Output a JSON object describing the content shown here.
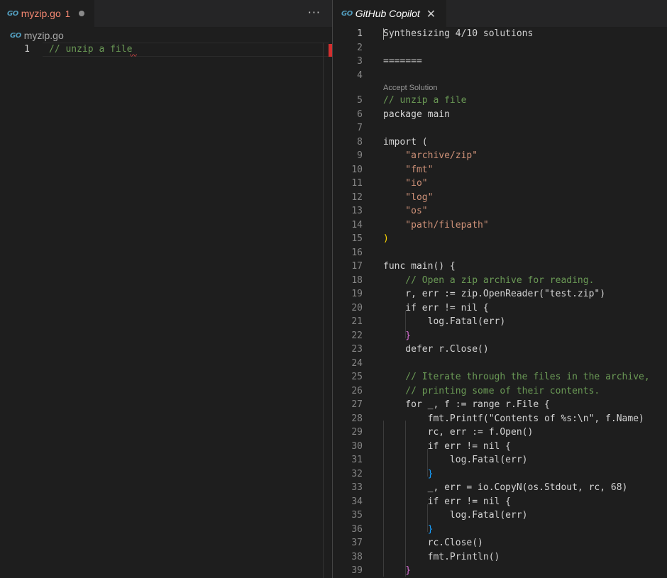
{
  "left_tab": {
    "icon": "GO",
    "title": "myzip.go",
    "problems": "1",
    "more": "···"
  },
  "breadcrumb": {
    "icon": "GO",
    "file": "myzip.go"
  },
  "left_editor": {
    "line_number": "1",
    "code": "// unzip a file"
  },
  "right_tab": {
    "icon": "GO",
    "title": "GitHub Copilot",
    "close": "✕"
  },
  "copilot": {
    "accept_solution": "Accept Solution"
  },
  "colors": {
    "background": "#1e1e1e",
    "tabbar": "#252526",
    "error": "#f48771",
    "comment": "#6a9955",
    "keyword": "#569cd6",
    "control": "#c586c0",
    "string": "#ce9178",
    "function": "#dcdcaa",
    "variable": "#9cdcfe"
  },
  "code_lines": [
    "Synthesizing 4/10 solutions",
    "",
    "=======",
    "",
    "// unzip a file",
    "package main",
    "",
    "import (",
    "    \"archive/zip\"",
    "    \"fmt\"",
    "    \"io\"",
    "    \"log\"",
    "    \"os\"",
    "    \"path/filepath\"",
    ")",
    "",
    "func main() {",
    "    // Open a zip archive for reading.",
    "    r, err := zip.OpenReader(\"test.zip\")",
    "    if err != nil {",
    "        log.Fatal(err)",
    "    }",
    "    defer r.Close()",
    "",
    "    // Iterate through the files in the archive,",
    "    // printing some of their contents.",
    "    for _, f := range r.File {",
    "        fmt.Printf(\"Contents of %s:\\n\", f.Name)",
    "        rc, err := f.Open()",
    "        if err != nil {",
    "            log.Fatal(err)",
    "        }",
    "        _, err = io.CopyN(os.Stdout, rc, 68)",
    "        if err != nil {",
    "            log.Fatal(err)",
    "        }",
    "        rc.Close()",
    "        fmt.Println()",
    "    }"
  ]
}
